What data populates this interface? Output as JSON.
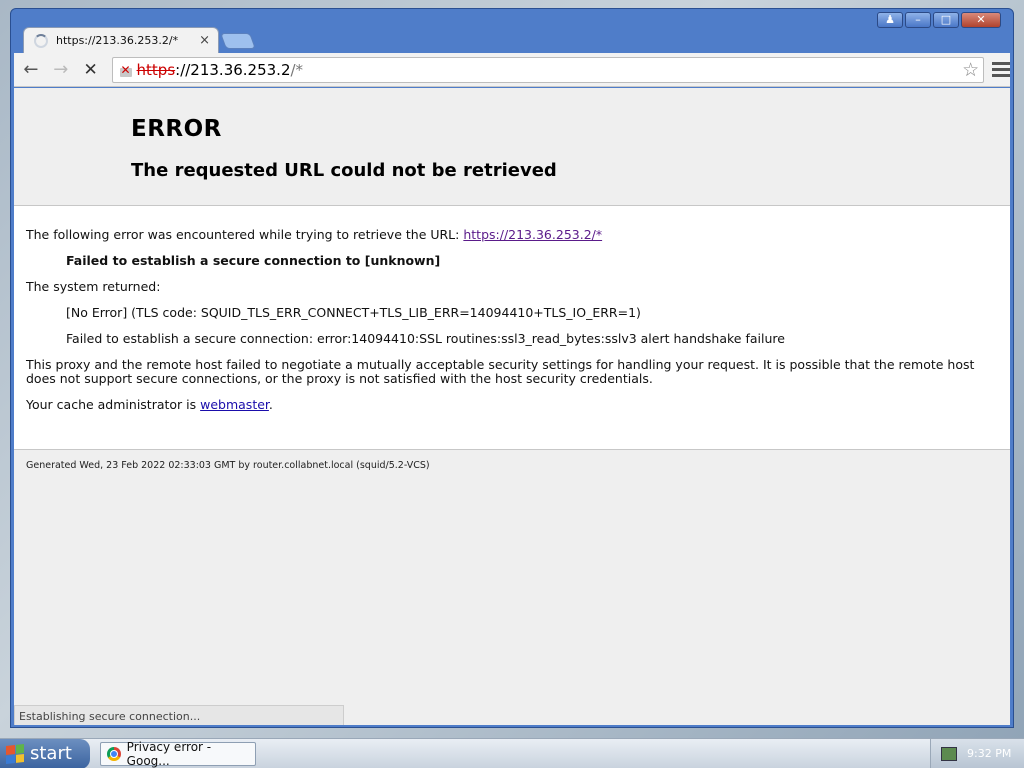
{
  "window": {
    "controls": [
      "♟",
      "–",
      "□",
      "✕"
    ]
  },
  "tab": {
    "title": "https://213.36.253.2/*",
    "close": "×"
  },
  "toolbar": {
    "back": "←",
    "forward": "→",
    "stop": "✕",
    "address": {
      "scheme": "https",
      "host": "://213.36.253.2",
      "path": "/*"
    },
    "star": "☆"
  },
  "page": {
    "title": "ERROR",
    "subtitle": "The requested URL could not be retrieved",
    "intro": "The following error was encountered while trying to retrieve the URL: ",
    "intro_link": "https://213.36.253.2/*",
    "error_summary": "Failed to establish a secure connection to [unknown]",
    "system_returned": "The system returned:",
    "detail_1": "[No Error] (TLS code: SQUID_TLS_ERR_CONNECT+TLS_LIB_ERR=14094410+TLS_IO_ERR=1)",
    "detail_2": "Failed to establish a secure connection: error:14094410:SSL routines:ssl3_read_bytes:sslv3 alert handshake failure",
    "explanation": "This proxy and the remote host failed to negotiate a mutually acceptable security settings for handling your request. It is possible that the remote host does not support secure connections, or the proxy is not satisfied with the host security credentials.",
    "admin_prefix": "Your cache administrator is ",
    "admin_link": "webmaster",
    "admin_suffix": ".",
    "footer": "Generated Wed, 23 Feb 2022 02:33:03 GMT by router.collabnet.local (squid/5.2-VCS)"
  },
  "status_bar": "Establishing secure connection...",
  "taskbar": {
    "start": "start",
    "task": "Privacy error - Goog...",
    "clock": "9:32 PM"
  },
  "colors": {
    "link": "#1a0dab",
    "visited_link": "#5a1b8a",
    "insecure_scheme": "#cc0000"
  }
}
